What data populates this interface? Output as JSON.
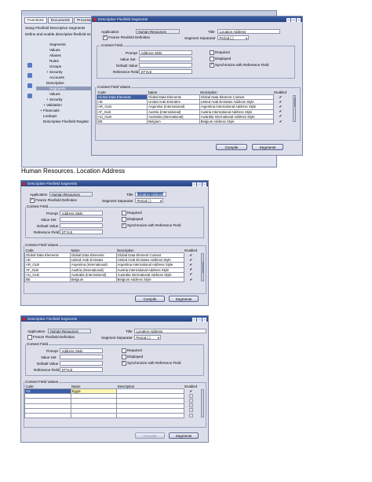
{
  "navigator": {
    "tabs": [
      "Functions",
      "Documents",
      "Processes"
    ],
    "heading1": "Setup Flexfield Descriptive Segments",
    "heading2": "Define and enable descriptive flexfield se",
    "tree": [
      "Segments",
      "Values",
      "Aliases",
      "Rules",
      "Groups",
      "+ Security",
      "Accounts",
      "Descriptive",
      "Segments",
      "Values",
      "+ Security",
      "+ Validation",
      "+ Financials",
      "Lookups",
      "Descriptive Flexfield Registe"
    ]
  },
  "caption": "Human Resources. Location Address",
  "labels": {
    "window_title": "Descriptive Flexfield Segments",
    "application": "Application",
    "title": "Title",
    "freeze": "Freeze Flexfield Definition",
    "segment_separator": "Segment Separator",
    "context_field": "Context Field",
    "prompt": "Prompt",
    "value_set": "Value Set",
    "default_value": "Default Value",
    "reference_field": "Reference Field",
    "required": "Required",
    "displayed": "Displayed",
    "synchronize": "Synchronize with Reference Field",
    "context_field_values": "Context Field Values",
    "col_code": "Code",
    "col_name": "Name",
    "col_description": "Description",
    "col_enabled": "Enabled",
    "compile": "Compile",
    "segments": "Segments"
  },
  "form": {
    "application": "Human Resources",
    "title": "Location Address",
    "separator": "Period (.)",
    "prompt": "Address Style",
    "reference_field": "STYLE"
  },
  "rows_full": [
    {
      "code": "Global Data Elements",
      "name": "Global Data Elements",
      "description": "Global Data Element Context"
    },
    {
      "code": "AE",
      "name": "United Arab Emirates",
      "description": "United Arab Emirates Address Style"
    },
    {
      "code": "AR_GLB",
      "name": "Argentina (International)",
      "description": "Argentina International Address Style"
    },
    {
      "code": "AT_GLB",
      "name": "Austria (International)",
      "description": "Austria International Address Style"
    },
    {
      "code": "AU_GLB",
      "name": "Australia (International)",
      "description": "Australia International Address Style"
    },
    {
      "code": "BE",
      "name": "Belgium",
      "description": "Belgium Address Style"
    }
  ],
  "row_new": {
    "code": "XX",
    "name": "Egypt",
    "description": ""
  },
  "enabled_mark": "✔",
  "icons": {
    "window": "app-icon",
    "check": "check-icon",
    "chevron": "chevron-down-icon"
  }
}
